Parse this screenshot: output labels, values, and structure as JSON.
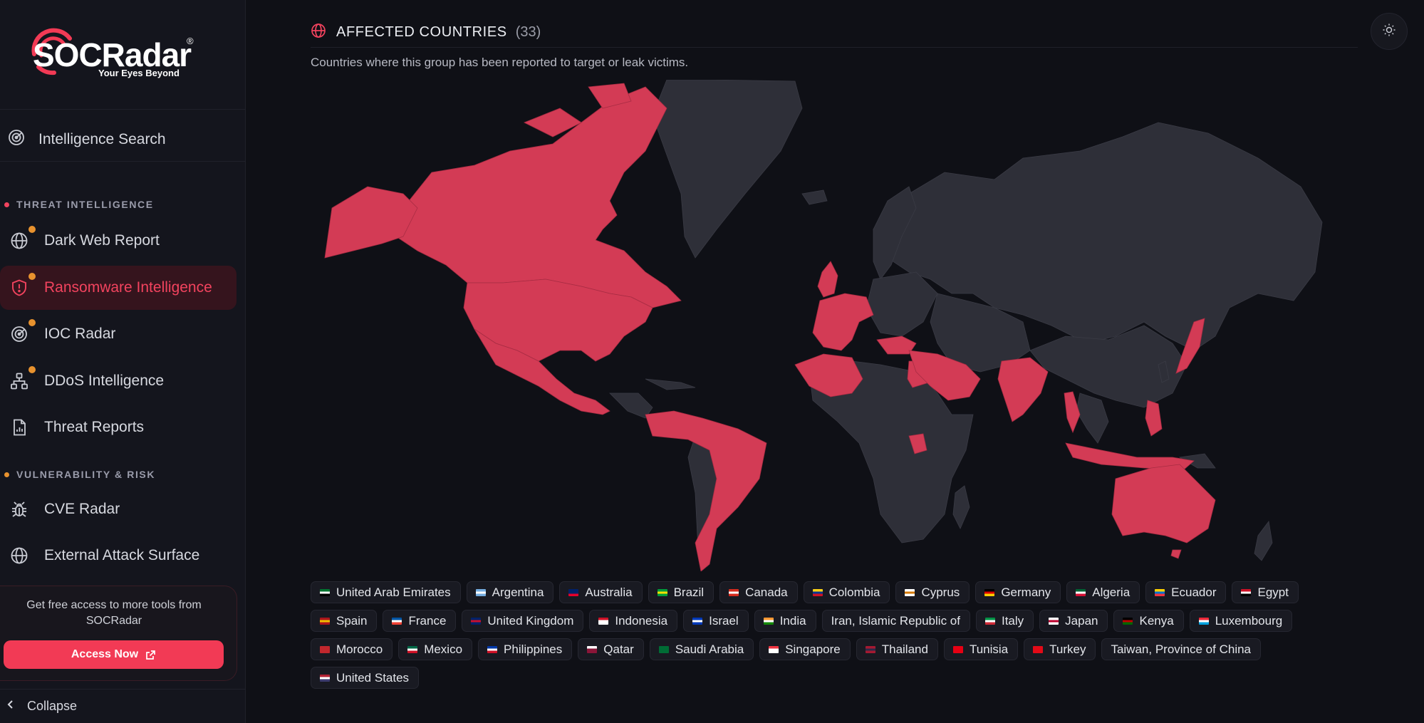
{
  "brand": {
    "name": "SOCRadar",
    "tagline": "Your Eyes Beyond",
    "accent": "#f23a55"
  },
  "sidebar": {
    "search": {
      "label": "Intelligence Search",
      "icon": "radar-icon"
    },
    "sections": [
      {
        "title": "THREAT INTELLIGENCE",
        "dot_color": "#f2435e",
        "items": [
          {
            "label": "Dark Web Report",
            "icon": "globe-icon",
            "badge": true,
            "active": false
          },
          {
            "label": "Ransomware Intelligence",
            "icon": "shield-alert-icon",
            "badge": true,
            "active": true
          },
          {
            "label": "IOC Radar",
            "icon": "radar-icon",
            "badge": true,
            "active": false
          },
          {
            "label": "DDoS Intelligence",
            "icon": "network-icon",
            "badge": true,
            "active": false
          },
          {
            "label": "Threat Reports",
            "icon": "document-icon",
            "badge": false,
            "active": false
          }
        ]
      },
      {
        "title": "VULNERABILITY & RISK",
        "dot_color": "#e8922e",
        "items": [
          {
            "label": "CVE Radar",
            "icon": "bug-icon",
            "badge": false,
            "active": false
          },
          {
            "label": "External Attack Surface",
            "icon": "globe-icon",
            "badge": false,
            "active": false
          }
        ]
      }
    ],
    "promo": {
      "text": "Get free access to more tools from SOCRadar",
      "button": "Access Now"
    },
    "collapse": "Collapse"
  },
  "main": {
    "title": "AFFECTED COUNTRIES",
    "count": "(33)",
    "subtitle": "Countries where this group has been reported to target or leak victims.",
    "map_colors": {
      "affected": "#d33b55",
      "unaffected": "#2e2f38",
      "ocean": "#0f1016"
    },
    "countries": [
      [
        {
          "name": "United Arab Emirates",
          "flag": [
            "#00732f",
            "#ffffff",
            "#000000"
          ]
        },
        {
          "name": "Argentina",
          "flag": [
            "#74acdf",
            "#ffffff",
            "#74acdf"
          ]
        },
        {
          "name": "Australia",
          "flag": [
            "#012169",
            "#012169",
            "#e4002b"
          ]
        },
        {
          "name": "Brazil",
          "flag": [
            "#009c3b",
            "#ffdf00",
            "#009c3b"
          ]
        },
        {
          "name": "Canada",
          "flag": [
            "#d52b1e",
            "#ffffff",
            "#d52b1e"
          ]
        },
        {
          "name": "Colombia",
          "flag": [
            "#fcd116",
            "#003893",
            "#ce1126"
          ]
        },
        {
          "name": "Cyprus",
          "flag": [
            "#ffffff",
            "#d57800",
            "#ffffff"
          ]
        },
        {
          "name": "Germany",
          "flag": [
            "#000000",
            "#dd0000",
            "#ffce00"
          ]
        },
        {
          "name": "Algeria",
          "flag": [
            "#006233",
            "#ffffff",
            "#d21034"
          ]
        },
        {
          "name": "Ecuador",
          "flag": [
            "#ffd100",
            "#0072ce",
            "#ef3340"
          ]
        },
        {
          "name": "Egypt",
          "flag": [
            "#ce1126",
            "#ffffff",
            "#000000"
          ]
        }
      ],
      [
        {
          "name": "Spain",
          "flag": [
            "#aa151b",
            "#f1bf00",
            "#aa151b"
          ]
        },
        {
          "name": "France",
          "flag": [
            "#0055a4",
            "#ffffff",
            "#ef4135"
          ]
        },
        {
          "name": "United Kingdom",
          "flag": [
            "#012169",
            "#c8102e",
            "#012169"
          ]
        },
        {
          "name": "Indonesia",
          "flag": [
            "#ce1126",
            "#ffffff",
            "#ffffff"
          ]
        },
        {
          "name": "Israel",
          "flag": [
            "#0038b8",
            "#ffffff",
            "#0038b8"
          ]
        },
        {
          "name": "India",
          "flag": [
            "#ff9933",
            "#ffffff",
            "#138808"
          ]
        },
        {
          "name": "Iran, Islamic Republic of",
          "flag": null
        },
        {
          "name": "Italy",
          "flag": [
            "#009246",
            "#ffffff",
            "#ce2b37"
          ]
        },
        {
          "name": "Japan",
          "flag": [
            "#ffffff",
            "#bc002d",
            "#ffffff"
          ]
        },
        {
          "name": "Kenya",
          "flag": [
            "#000000",
            "#bb0000",
            "#006600"
          ]
        },
        {
          "name": "Luxembourg",
          "flag": [
            "#ed2939",
            "#ffffff",
            "#00a1de"
          ]
        }
      ],
      [
        {
          "name": "Morocco",
          "flag": [
            "#c1272d",
            "#c1272d",
            "#c1272d"
          ]
        },
        {
          "name": "Mexico",
          "flag": [
            "#006847",
            "#ffffff",
            "#ce1126"
          ]
        },
        {
          "name": "Philippines",
          "flag": [
            "#0038a8",
            "#ffffff",
            "#ce1126"
          ]
        },
        {
          "name": "Qatar",
          "flag": [
            "#ffffff",
            "#8a1538",
            "#8a1538"
          ]
        },
        {
          "name": "Saudi Arabia",
          "flag": [
            "#006c35",
            "#006c35",
            "#006c35"
          ]
        },
        {
          "name": "Singapore",
          "flag": [
            "#ef3340",
            "#ffffff",
            "#ffffff"
          ]
        },
        {
          "name": "Thailand",
          "flag": [
            "#a51931",
            "#2d2a4a",
            "#a51931"
          ]
        },
        {
          "name": "Tunisia",
          "flag": [
            "#e70013",
            "#e70013",
            "#e70013"
          ]
        },
        {
          "name": "Turkey",
          "flag": [
            "#e30a17",
            "#e30a17",
            "#e30a17"
          ]
        },
        {
          "name": "Taiwan, Province of China",
          "flag": null
        }
      ],
      [
        {
          "name": "United States",
          "flag": [
            "#b22234",
            "#ffffff",
            "#3c3b6e"
          ]
        }
      ]
    ]
  }
}
